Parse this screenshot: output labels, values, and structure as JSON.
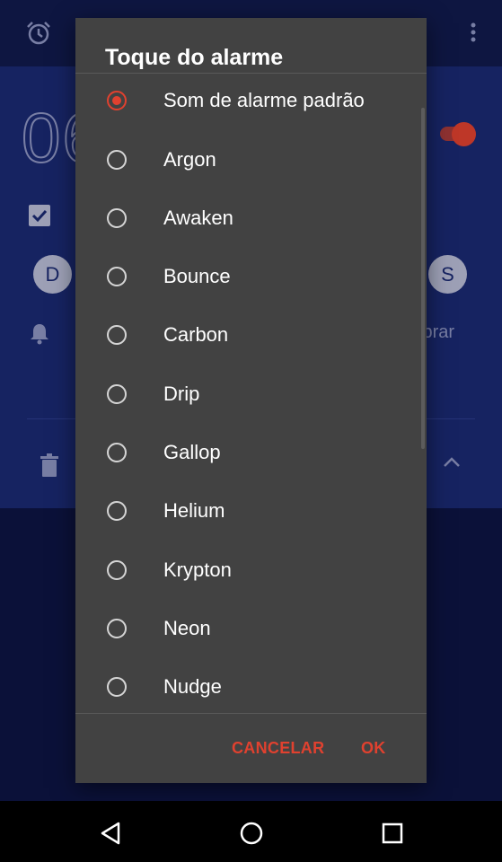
{
  "background": {
    "time_partial": "06",
    "day_first": "D",
    "day_last": "S",
    "vibrate_partial": "ibrar"
  },
  "dialog": {
    "title": "Toque do alarme",
    "options": [
      {
        "label": "Som de alarme padrão",
        "selected": true
      },
      {
        "label": "Argon",
        "selected": false
      },
      {
        "label": "Awaken",
        "selected": false
      },
      {
        "label": "Bounce",
        "selected": false
      },
      {
        "label": "Carbon",
        "selected": false
      },
      {
        "label": "Drip",
        "selected": false
      },
      {
        "label": "Gallop",
        "selected": false
      },
      {
        "label": "Helium",
        "selected": false
      },
      {
        "label": "Krypton",
        "selected": false
      },
      {
        "label": "Neon",
        "selected": false
      },
      {
        "label": "Nudge",
        "selected": false
      }
    ],
    "cancel_label": "CANCELAR",
    "ok_label": "OK"
  },
  "colors": {
    "accent": "#e0412f",
    "dialog_bg": "#424242",
    "app_bg": "#1b2a72"
  },
  "icons": {
    "alarm": "alarm-clock-icon",
    "menu": "overflow-menu-icon",
    "bell": "bell-icon",
    "trash": "trash-icon",
    "expand": "chevron-up-icon",
    "nav_back": "back-triangle-icon",
    "nav_home": "home-circle-icon",
    "nav_recent": "recents-square-icon"
  }
}
